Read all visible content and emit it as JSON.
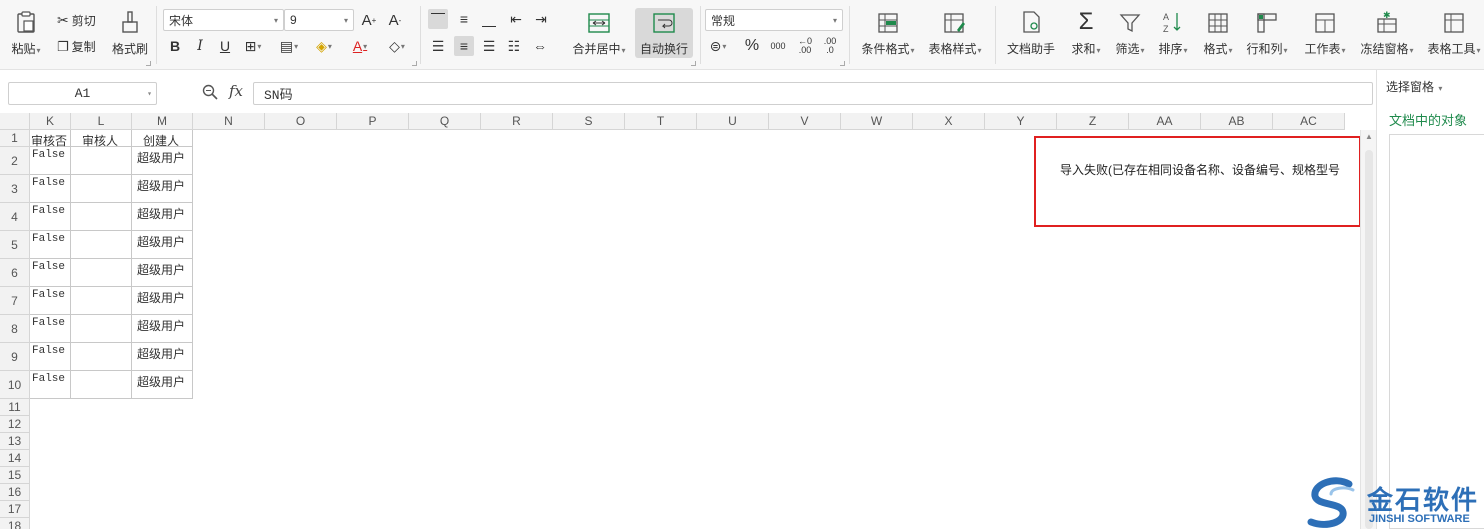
{
  "ribbon": {
    "paste": "粘贴",
    "cut": "剪切",
    "copy": "复制",
    "format_painter": "格式刷",
    "font_name": "宋体",
    "font_size": "9",
    "merge_center": "合并居中",
    "wrap_text": "自动换行",
    "number_format": "常规",
    "conditional_format": "条件格式",
    "table_style": "表格样式",
    "doc_helper": "文档助手",
    "sum": "求和",
    "filter": "筛选",
    "sort": "排序",
    "format": "格式",
    "row_col": "行和列",
    "worksheet": "工作表",
    "freeze": "冻结窗格",
    "table_tools": "表格工具",
    "percent": "%",
    "decimal_inc": ".00",
    "decimal_dec": ".0"
  },
  "formula_bar": {
    "cell_ref": "A1",
    "fx": "fx",
    "content": "SN码"
  },
  "grid": {
    "columns": [
      "K",
      "L",
      "M",
      "N",
      "O",
      "P",
      "Q",
      "R",
      "S",
      "T",
      "U",
      "V",
      "W",
      "X",
      "Y",
      "Z",
      "AA",
      "AB",
      "AC"
    ],
    "rows": [
      "1",
      "2",
      "3",
      "4",
      "5",
      "6",
      "7",
      "8",
      "9",
      "10",
      "11",
      "12",
      "13",
      "14",
      "15",
      "16",
      "17",
      "18"
    ],
    "headers": [
      "审核否",
      "审核人",
      "创建人"
    ],
    "data_rows": [
      [
        "False",
        "",
        "超级用户"
      ],
      [
        "False",
        "",
        "超级用户"
      ],
      [
        "False",
        "",
        "超级用户"
      ],
      [
        "False",
        "",
        "超级用户"
      ],
      [
        "False",
        "",
        "超级用户"
      ],
      [
        "False",
        "",
        "超级用户"
      ],
      [
        "False",
        "",
        "超级用户"
      ],
      [
        "False",
        "",
        "超级用户"
      ],
      [
        "False",
        "",
        "超级用户"
      ]
    ],
    "error_message": "导入失败(已存在相同设备名称、设备编号、规格型号"
  },
  "pane": {
    "title": "选择窗格",
    "subtitle": "文档中的对象"
  },
  "watermark": {
    "cn": "金石软件",
    "en": "JINSHI SOFTWARE"
  },
  "colors": {
    "accent_green": "#1f8a4c",
    "highlight_red": "#e02020",
    "brand_blue": "#2d6fb7"
  }
}
